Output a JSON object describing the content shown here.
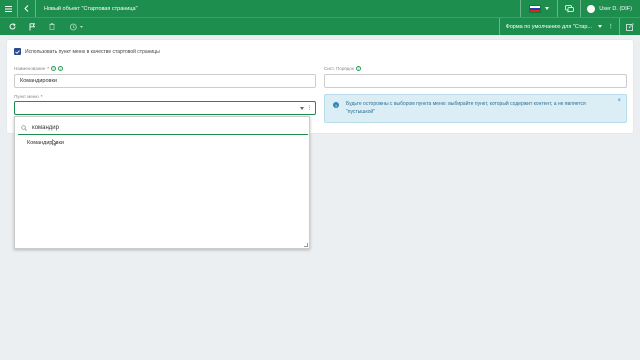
{
  "topbar": {
    "title": "Новый объект \"Стартовая страница\"",
    "user": "User D. (DIF)",
    "colors": {
      "brand": "#1e8e4e"
    }
  },
  "toolbar": {
    "form_select_label": "Форма по умолчанию для \"Стар..."
  },
  "form": {
    "use_as_start_label": "Использовать пункт меню в качестве стартовой страницы",
    "use_as_start_checked": true,
    "name_label": "Наименование",
    "name_value": "Командировки",
    "sort_label": "Сист. Порядок",
    "sort_value": "",
    "menu_item_label": "Пункт меню",
    "menu_item_value": "",
    "required_mark": "*"
  },
  "alert": {
    "text": "Будьте осторожны с выбором пункта меню: выбирайте пункт, который содержит контент, а не является \"пустышкой\""
  },
  "dropdown": {
    "search_value": "командир",
    "results": [
      "Командировки"
    ]
  }
}
